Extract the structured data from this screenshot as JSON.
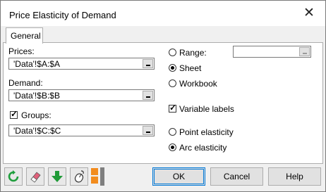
{
  "window": {
    "title": "Price Elasticity of Demand",
    "close_glyph": "✕"
  },
  "tabs": [
    {
      "label": "General"
    }
  ],
  "prices": {
    "label": "Prices:",
    "value": "'Data'!$A:$A"
  },
  "demand": {
    "label": "Demand:",
    "value": "'Data'!$B:$B"
  },
  "groups": {
    "label": "Groups:",
    "checked": true,
    "value": "'Data'!$C:$C"
  },
  "output": {
    "range_label": "Range:",
    "range_value": "",
    "sheet_label": "Sheet",
    "workbook_label": "Workbook",
    "selected": "Sheet"
  },
  "variable_labels": {
    "label": "Variable labels",
    "checked": true
  },
  "elasticity": {
    "point_label": "Point elasticity",
    "arc_label": "Arc elasticity",
    "selected": "Arc elasticity"
  },
  "toolbar_icons": [
    "refresh-icon",
    "eraser-icon",
    "down-arrow-icon",
    "mouse-icon",
    "color-squares-icon"
  ],
  "buttons": {
    "ok": "OK",
    "cancel": "Cancel",
    "help": "Help"
  },
  "check_glyph": "✓",
  "colors": {
    "refresh": "#1e9e3c",
    "down_arrow": "#1f9a37",
    "orange": "#f28c1e",
    "gray_bar": "#7f7f7f",
    "accent": "#0078d7"
  }
}
